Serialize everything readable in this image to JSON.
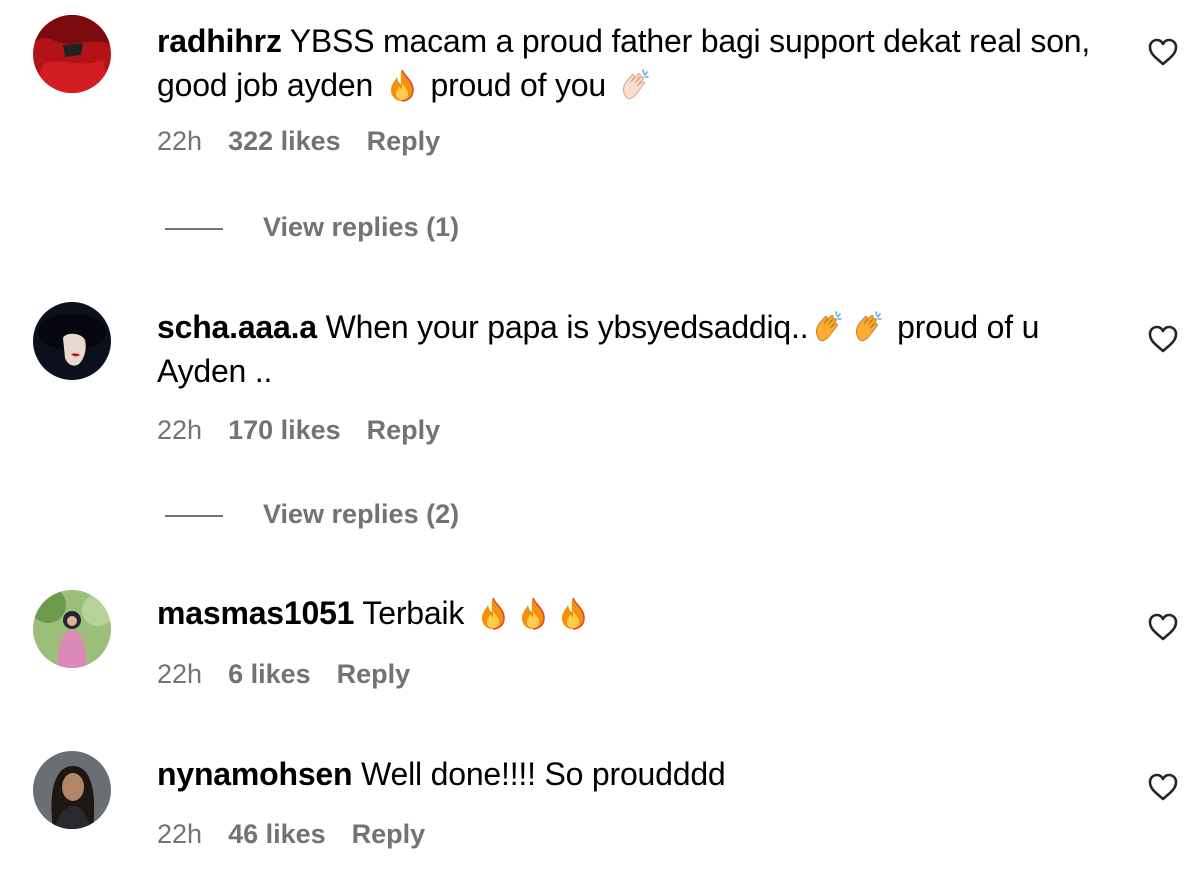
{
  "comments": [
    {
      "username": "radhihrz",
      "text_parts": [
        "YBSS macam a proud father bagi support dekat real son, good job ayden",
        "proud of you"
      ],
      "emojis": [
        "fire-emoji",
        "clapping-hands-emoji"
      ],
      "time": "22h",
      "likes": "322 likes",
      "reply": "Reply",
      "view_replies": "View replies (1)",
      "avatar_icon": "avatar-red-jacket"
    },
    {
      "username": "scha.aaa.a",
      "text_parts": [
        "When your papa is ybsyedsaddiq..",
        "proud of u Ayden .."
      ],
      "emojis": [
        "clapping-hands-emoji",
        "clapping-hands-emoji"
      ],
      "time": "22h",
      "likes": "170 likes",
      "reply": "Reply",
      "view_replies": "View replies (2)",
      "avatar_icon": "avatar-dark-silhouette"
    },
    {
      "username": "masmas1051",
      "text_parts": [
        "Terbaik"
      ],
      "emojis": [
        "fire-emoji",
        "fire-emoji",
        "fire-emoji"
      ],
      "time": "22h",
      "likes": "6 likes",
      "reply": "Reply",
      "avatar_icon": "avatar-outdoor-portrait"
    },
    {
      "username": "nynamohsen",
      "text_parts": [
        "Well done!!!! So proudddd"
      ],
      "time": "22h",
      "likes": "46 likes",
      "reply": "Reply",
      "avatar_icon": "avatar-woman-portrait"
    }
  ],
  "colors": {
    "meta_text": "#737373",
    "text": "#000000",
    "background": "#ffffff"
  },
  "icons": {
    "like": "heart-outline-icon"
  }
}
